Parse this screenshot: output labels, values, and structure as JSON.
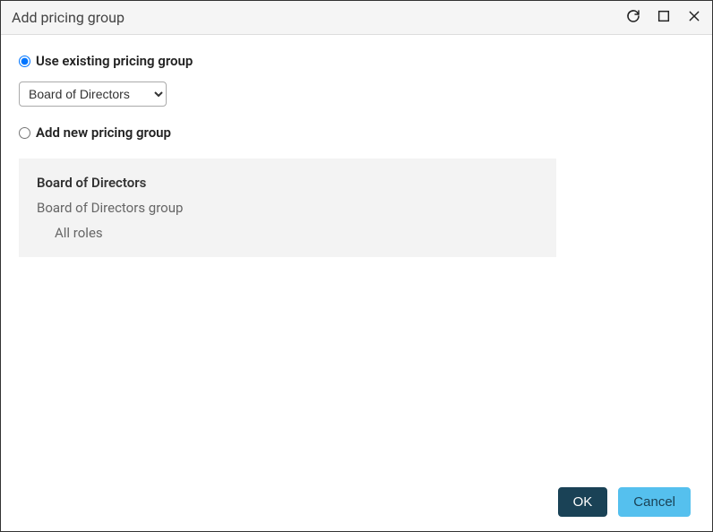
{
  "titlebar": {
    "title": "Add pricing group"
  },
  "options": {
    "use_existing_label": "Use existing pricing group",
    "add_new_label": "Add new pricing group",
    "selected_group": "Board of Directors"
  },
  "details": {
    "title": "Board of Directors",
    "subtitle": "Board of Directors group",
    "roles": "All roles"
  },
  "footer": {
    "ok_label": "OK",
    "cancel_label": "Cancel"
  }
}
